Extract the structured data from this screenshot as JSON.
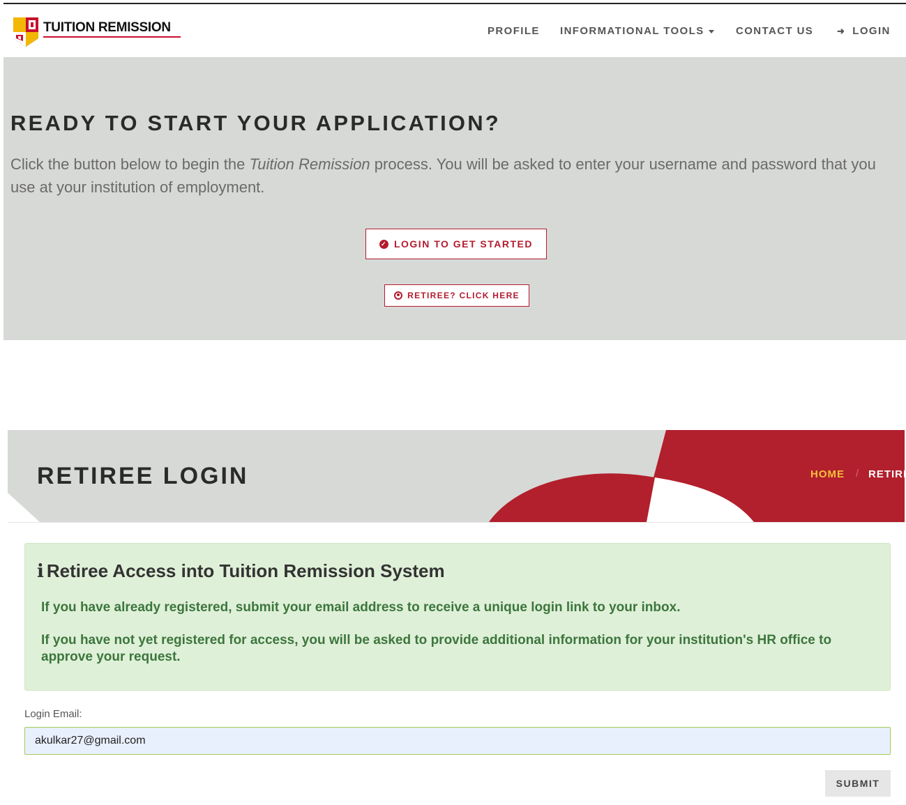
{
  "header": {
    "brand": "TUITION REMISSION",
    "nav": {
      "profile": "PROFILE",
      "informational_tools": "INFORMATIONAL TOOLS",
      "contact_us": "CONTACT US",
      "login": "LOGIN"
    }
  },
  "hero": {
    "title": "READY TO START YOUR APPLICATION?",
    "text_before": "Click the button below to begin the ",
    "text_italic": "Tuition Remission",
    "text_after": " process. You will be asked to enter your username and password that you use at your institution of employment.",
    "primary_button": "LOGIN TO GET STARTED",
    "secondary_button": "RETIREE? CLICK HERE"
  },
  "retiree": {
    "title": "RETIREE LOGIN",
    "breadcrumb": {
      "home": "HOME",
      "separator": "/",
      "current": "RETIREE LOGIN"
    }
  },
  "alert": {
    "title": "Retiree Access into Tuition Remission System",
    "p1": "If you have already registered, submit your email address to receive a unique login link to your inbox.",
    "p2": "If you have not yet registered for access, you will be asked to provide additional information for your institution's HR office to approve your request."
  },
  "form": {
    "email_label": "Login Email:",
    "email_value": "akulkar27@gmail.com",
    "submit_label": "SUBMIT"
  },
  "colors": {
    "brand_red": "#b31b2e",
    "hero_bg": "#d7d9d6",
    "alert_bg": "#dff0d8",
    "alert_text": "#3c763d",
    "breadcrumb_home": "#f5c03a"
  }
}
